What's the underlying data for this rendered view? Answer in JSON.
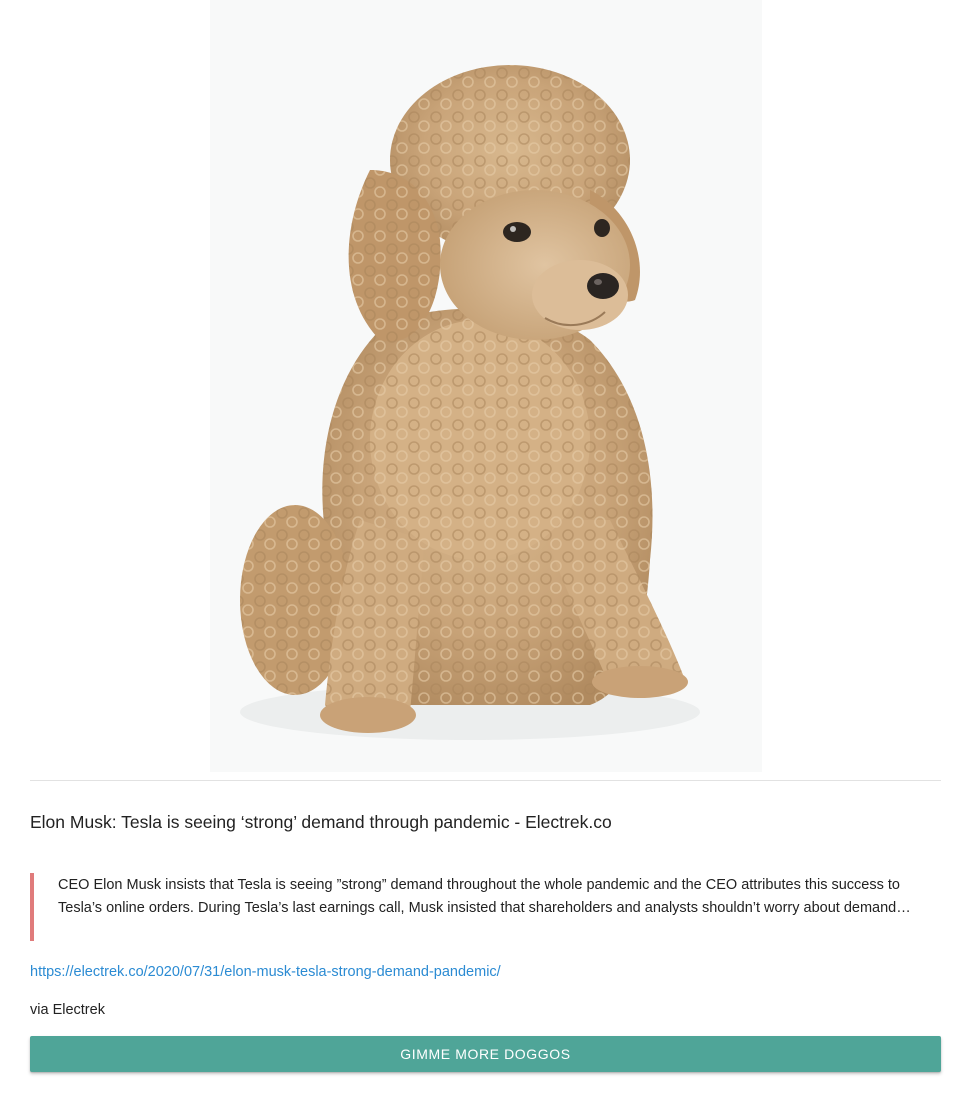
{
  "image": {
    "alt": "",
    "subject_icon": "poodle-puppy-photo"
  },
  "article": {
    "title": "Elon Musk: Tesla is seeing ‘strong’ demand through pandemic - Electrek.co",
    "excerpt": "CEO Elon Musk insists that Tesla is seeing ”strong” demand throughout the whole pandemic and the CEO attributes this success to Tesla’s online orders. During Tesla’s last earnings call, Musk insisted that shareholders and analysts shouldn’t worry about demand…",
    "url": "https://electrek.co/2020/07/31/elon-musk-tesla-strong-demand-pandemic/",
    "via": "via Electrek"
  },
  "actions": {
    "more_label": "Gimme more doggos"
  },
  "colors": {
    "accent": "#4fa598",
    "quote_border": "#e07b7b",
    "link": "#2b8bd3"
  }
}
